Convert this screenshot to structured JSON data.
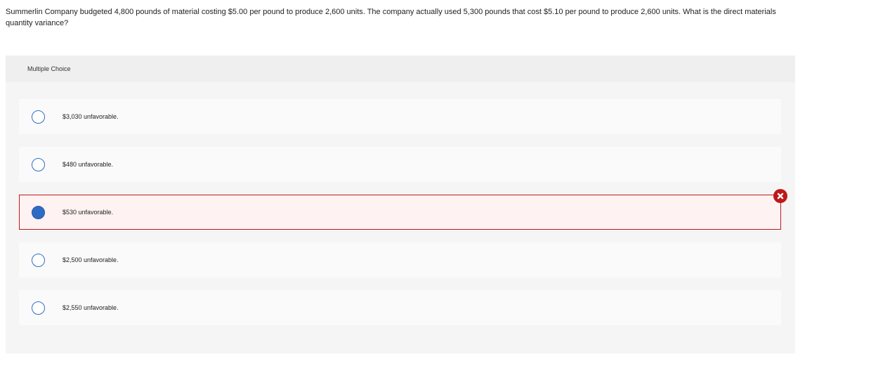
{
  "question": {
    "text": "Summerlin Company budgeted 4,800 pounds of material costing $5.00 per pound to produce 2,600 units. The company actually used 5,300 pounds that cost $5.10 per pound to produce 2,600 units. What is the direct materials quantity variance?"
  },
  "panel": {
    "header": "Multiple Choice"
  },
  "options": [
    {
      "label": "$3,030 unfavorable.",
      "selected": false,
      "status": ""
    },
    {
      "label": "$480 unfavorable.",
      "selected": false,
      "status": ""
    },
    {
      "label": "$530 unfavorable.",
      "selected": true,
      "status": "incorrect"
    },
    {
      "label": "$2,500 unfavorable.",
      "selected": false,
      "status": ""
    },
    {
      "label": "$2,550 unfavorable.",
      "selected": false,
      "status": ""
    }
  ],
  "icons": {
    "incorrect": "close-circle-icon"
  },
  "colors": {
    "accent": "#2e6cc4",
    "error": "#c01818"
  }
}
